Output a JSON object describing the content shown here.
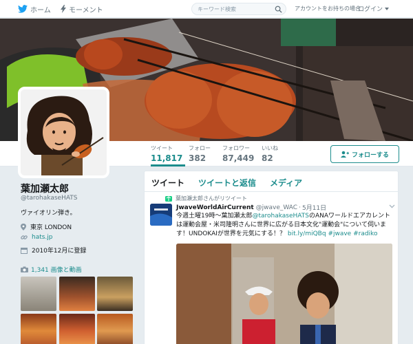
{
  "topnav": {
    "home_label": "ホーム",
    "moments_label": "モーメント",
    "search_placeholder": "キーワード検索",
    "account_prompt": "アカウントをお持ちの場合",
    "login_label": "ログイン"
  },
  "profile_nav": {
    "stats": [
      {
        "label": "ツイート",
        "value": "11,817"
      },
      {
        "label": "フォロー",
        "value": "382"
      },
      {
        "label": "フォロワー",
        "value": "87,449"
      },
      {
        "label": "いいね",
        "value": "82"
      }
    ],
    "follow_label": "フォローする"
  },
  "profile": {
    "name": "葉加瀬太郎",
    "handle": "@tarohakaseHATS",
    "bio": "ヴァイオリン弾き。",
    "location": "東京 LONDON",
    "url": "hats.jp",
    "joined": "2010年12月に登録",
    "media_link": "1,341 画像と動画"
  },
  "timeline": {
    "tabs": [
      "ツイート",
      "ツイートと返信",
      "メディア"
    ],
    "retweet_notice": "葉加瀬太郎さんがリツイート",
    "tweet": {
      "name": "JwaveWorldAirCurrent",
      "handle": "@jwave_WAC",
      "date": "5月11日",
      "body_1": "今週土曜19時〜葉加瀬太郎",
      "body_mention": "@tarohakaseHATS",
      "body_2": "のANAワールドエアカレントは運動会屋・米司隆明さんに世界に広がる日本文化\"運動会\"について伺います！UNDOKAIが世界を元気にする！？",
      "body_link": "bit.ly/miQBq",
      "body_tags": "#jwave #radiko"
    }
  },
  "colors": {
    "accent": "#1b8c8c",
    "twitter_blue": "#1da1f2"
  }
}
